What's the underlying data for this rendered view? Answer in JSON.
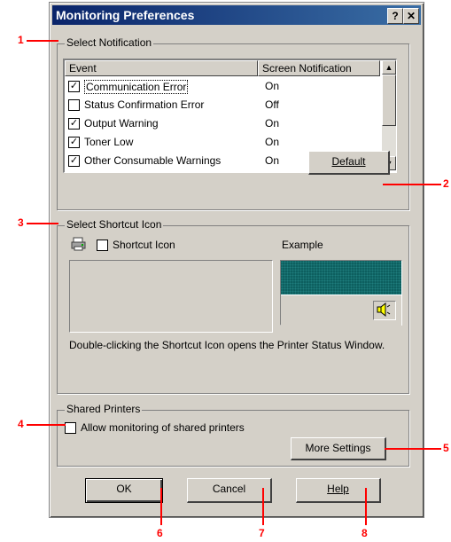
{
  "window": {
    "title": "Monitoring Preferences",
    "help_btn": "?",
    "close_btn": "✕"
  },
  "notification": {
    "group_label": "Select Notification",
    "col_event": "Event",
    "col_screen": "Screen Notification",
    "rows": [
      {
        "checked": true,
        "check_mark": "☑",
        "event": "Communication Error",
        "screen": "On"
      },
      {
        "checked": false,
        "check_mark": "☐",
        "event": "Status Confirmation Error",
        "screen": "Off"
      },
      {
        "checked": true,
        "check_mark": "☑",
        "event": "Output Warning",
        "screen": "On"
      },
      {
        "checked": true,
        "check_mark": "☑",
        "event": "Toner Low",
        "screen": "On"
      },
      {
        "checked": true,
        "check_mark": "☑",
        "event": "Other Consumable Warnings",
        "screen": "On"
      }
    ],
    "default_btn": "Default"
  },
  "shortcut": {
    "group_label": "Select Shortcut Icon",
    "checkbox_label": "Shortcut Icon",
    "example_label": "Example",
    "description": "Double-clicking the Shortcut Icon opens the Printer Status Window."
  },
  "shared": {
    "group_label": "Shared Printers",
    "checkbox_label": "Allow monitoring of shared printers",
    "more_btn": "More Settings"
  },
  "buttons": {
    "ok": "OK",
    "cancel": "Cancel",
    "help": "Help"
  },
  "callouts": [
    "1",
    "2",
    "3",
    "4",
    "5",
    "6",
    "7",
    "8"
  ],
  "colors": {
    "title_bar": "#0a246a",
    "dialog": "#d4d0c8",
    "example_teal": "#0d5f5f",
    "callout": "#ff0000"
  }
}
